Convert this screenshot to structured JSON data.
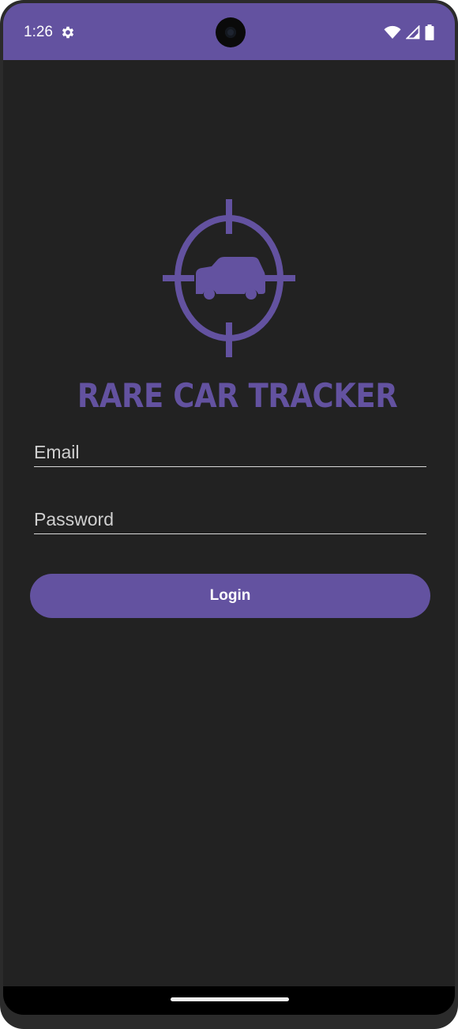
{
  "status_bar": {
    "time": "1:26",
    "settings_icon": "gear-icon",
    "wifi_icon": "wifi-icon",
    "signal_icon": "cell-signal-icon",
    "battery_icon": "battery-icon"
  },
  "app": {
    "logo_icon": "crosshair-car-logo",
    "title": "RARE CAR TRACKER",
    "accent_color": "#6352a0",
    "background_color": "#222222"
  },
  "login_form": {
    "email_placeholder": "Email",
    "email_value": "",
    "password_placeholder": "Password",
    "password_value": "",
    "login_label": "Login"
  }
}
